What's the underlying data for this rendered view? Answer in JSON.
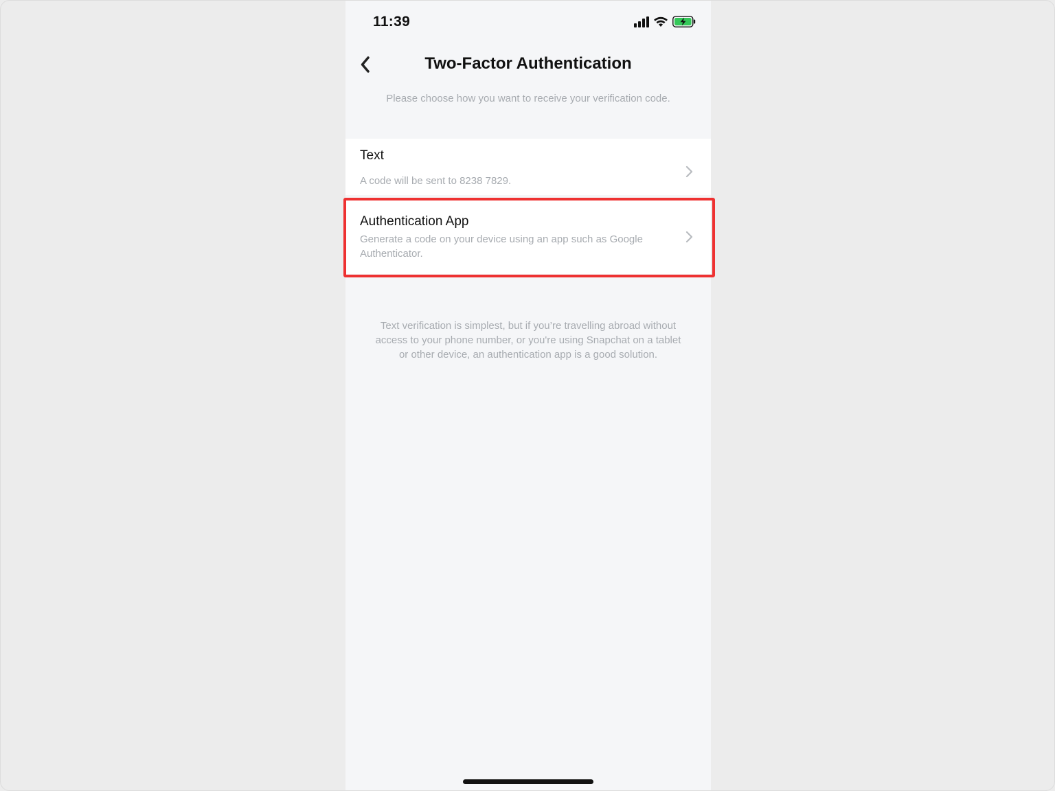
{
  "status_bar": {
    "time": "11:39",
    "icons": [
      "cellular-signal-icon",
      "wifi-icon",
      "battery-charging-icon"
    ],
    "battery_color": "#34c759"
  },
  "nav": {
    "back_icon": "chevron-left-icon",
    "title": "Two-Factor Authentication"
  },
  "subtitle": "Please choose how you want to receive your verification code.",
  "options": [
    {
      "title": "Text",
      "description": "A code will be sent to 8238 7829.",
      "icon": "chevron-right-icon"
    },
    {
      "title": "Authentication App",
      "description": "Generate a code on your device using an app such as Google Authenticator.",
      "icon": "chevron-right-icon",
      "highlighted": true
    }
  ],
  "footnote": "Text verification is simplest, but if you’re travelling abroad without access to your phone number, or you're using Snapchat on a tablet or other device, an authentication app is a good solution.",
  "colors": {
    "highlight": "#ee3131",
    "background": "#f5f6f8",
    "muted_text": "#a7abb0"
  }
}
